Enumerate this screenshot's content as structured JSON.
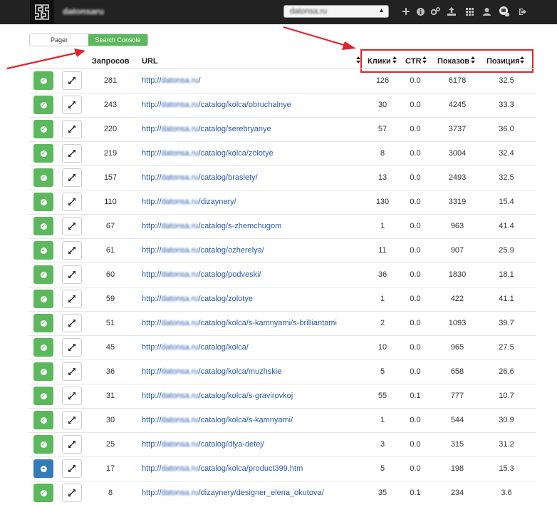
{
  "navbar": {
    "brand": "datonsaru",
    "site_select_value": "datonsa.ru",
    "icons": [
      "plus-icon",
      "info-icon",
      "gears-icon",
      "upload-icon",
      "grid-icon",
      "user-icon",
      "account-avatar-icon",
      "logout-icon"
    ]
  },
  "toggle": {
    "pager_label": "Pager",
    "search_console_label": "Search Console"
  },
  "table": {
    "headers": {
      "requests": "Запросов",
      "url": "URL",
      "clicks": "Клики",
      "ctr": "CTR",
      "impressions": "Показов",
      "position": "Позиция"
    },
    "url_prefix": "http://",
    "url_domain": "datonsa.ru",
    "rows": [
      {
        "requests": "281",
        "path": "/",
        "clicks": "126",
        "ctr": "0.0",
        "impressions": "6178",
        "position": "32.5",
        "state": "check"
      },
      {
        "requests": "243",
        "path": "/catalog/kolca/obruchalnye",
        "clicks": "30",
        "ctr": "0.0",
        "impressions": "4245",
        "position": "33.3",
        "state": "check"
      },
      {
        "requests": "220",
        "path": "/catalog/serebryanye",
        "clicks": "57",
        "ctr": "0.0",
        "impressions": "3737",
        "position": "36.0",
        "state": "check"
      },
      {
        "requests": "219",
        "path": "/catalog/kolca/zolotye",
        "clicks": "8",
        "ctr": "0.0",
        "impressions": "3004",
        "position": "32.4",
        "state": "check"
      },
      {
        "requests": "157",
        "path": "/catalog/braslety/",
        "clicks": "13",
        "ctr": "0.0",
        "impressions": "2493",
        "position": "32.5",
        "state": "check"
      },
      {
        "requests": "110",
        "path": "/dizaynery/",
        "clicks": "130",
        "ctr": "0.0",
        "impressions": "3319",
        "position": "15.4",
        "state": "check"
      },
      {
        "requests": "67",
        "path": "/catalog/s-zhemchugom",
        "clicks": "1",
        "ctr": "0.0",
        "impressions": "963",
        "position": "41.4",
        "state": "check"
      },
      {
        "requests": "61",
        "path": "/catalog/ozherelya/",
        "clicks": "11",
        "ctr": "0.0",
        "impressions": "907",
        "position": "25.9",
        "state": "check"
      },
      {
        "requests": "60",
        "path": "/catalog/podveski/",
        "clicks": "36",
        "ctr": "0.0",
        "impressions": "1830",
        "position": "18.1",
        "state": "check"
      },
      {
        "requests": "59",
        "path": "/catalog/zolotye",
        "clicks": "1",
        "ctr": "0.0",
        "impressions": "422",
        "position": "41.1",
        "state": "check"
      },
      {
        "requests": "51",
        "path": "/catalog/kolca/s-kamnyami/s-brilliantami",
        "clicks": "2",
        "ctr": "0.0",
        "impressions": "1093",
        "position": "39.7",
        "state": "check"
      },
      {
        "requests": "45",
        "path": "/catalog/kolca/",
        "clicks": "10",
        "ctr": "0.0",
        "impressions": "965",
        "position": "27.5",
        "state": "check"
      },
      {
        "requests": "36",
        "path": "/catalog/kolca/muzhskie",
        "clicks": "5",
        "ctr": "0.0",
        "impressions": "658",
        "position": "26.6",
        "state": "check"
      },
      {
        "requests": "31",
        "path": "/catalog/kolca/s-gravirovkoj",
        "clicks": "55",
        "ctr": "0.1",
        "impressions": "777",
        "position": "10.7",
        "state": "check"
      },
      {
        "requests": "30",
        "path": "/catalog/kolca/s-kamnyami/",
        "clicks": "1",
        "ctr": "0.0",
        "impressions": "544",
        "position": "30.9",
        "state": "check"
      },
      {
        "requests": "25",
        "path": "/catalog/dlya-detej/",
        "clicks": "3",
        "ctr": "0.0",
        "impressions": "315",
        "position": "31.2",
        "state": "check"
      },
      {
        "requests": "17",
        "path": "/catalog/kolca/product399.htm",
        "clicks": "5",
        "ctr": "0.0",
        "impressions": "198",
        "position": "15.3",
        "state": "add"
      },
      {
        "requests": "8",
        "path": "/dizaynery/designer_elena_okutova/",
        "clicks": "35",
        "ctr": "0.1",
        "impressions": "234",
        "position": "3.6",
        "state": "check"
      }
    ]
  },
  "colors": {
    "navbar_bg": "#222222",
    "success_green": "#5cb85c",
    "primary_blue": "#337ab7",
    "link_blue": "#2a5aa8",
    "annotation_red": "#e0252a"
  }
}
